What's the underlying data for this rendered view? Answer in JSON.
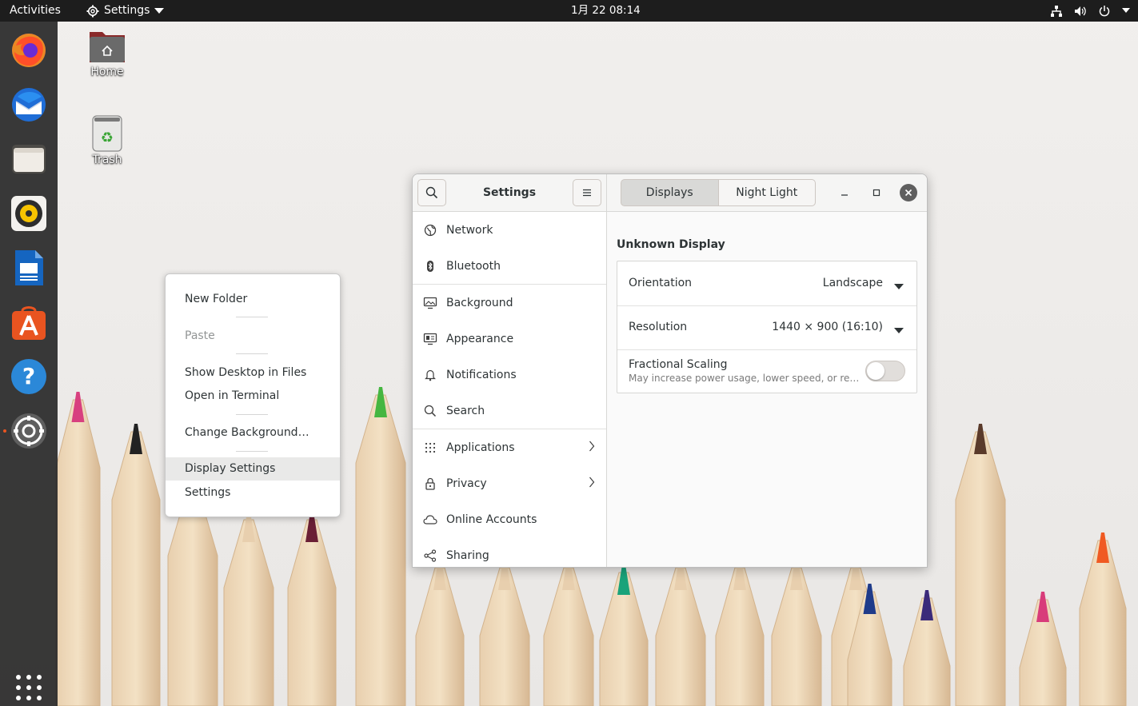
{
  "topbar": {
    "activities": "Activities",
    "app_menu": "Settings",
    "clock": "1月 22  08:14"
  },
  "dock": {
    "items": [
      "firefox-icon",
      "thunderbird-icon",
      "files-icon",
      "rhythmbox-icon",
      "libreoffice-writer-icon",
      "ubuntu-software-icon",
      "help-icon",
      "settings-icon"
    ],
    "show_apps": "show-applications-icon",
    "accent": "#e95420"
  },
  "desktop": {
    "home_label": "Home",
    "trash_label": "Trash"
  },
  "context_menu": {
    "items": [
      {
        "label": "New Folder",
        "enabled": true
      },
      {
        "label": "Paste",
        "enabled": false
      },
      {
        "label": "Show Desktop in Files",
        "enabled": true
      },
      {
        "label": "Open in Terminal",
        "enabled": true
      },
      {
        "label": "Change Background…",
        "enabled": true
      },
      {
        "label": "Display Settings",
        "enabled": true,
        "highlighted": true
      },
      {
        "label": "Settings",
        "enabled": true
      }
    ]
  },
  "settings": {
    "title": "Settings",
    "tabs": [
      "Displays",
      "Night Light"
    ],
    "active_tab": "Displays",
    "sidebar": [
      {
        "label": "Network",
        "icon": "network-icon"
      },
      {
        "label": "Bluetooth",
        "icon": "bluetooth-icon"
      },
      {
        "label": "Background",
        "icon": "background-icon"
      },
      {
        "label": "Appearance",
        "icon": "appearance-icon"
      },
      {
        "label": "Notifications",
        "icon": "bell-icon"
      },
      {
        "label": "Search",
        "icon": "search-icon"
      },
      {
        "label": "Applications",
        "icon": "applications-grid-icon"
      },
      {
        "label": "Privacy",
        "icon": "lock-icon"
      },
      {
        "label": "Online Accounts",
        "icon": "cloud-icon"
      },
      {
        "label": "Sharing",
        "icon": "share-icon"
      }
    ],
    "display": {
      "name": "Unknown Display",
      "orientation_label": "Orientation",
      "orientation_value": "Landscape",
      "resolution_label": "Resolution",
      "resolution_value": "1440 × 900 (16:10)",
      "fractional_label": "Fractional Scaling",
      "fractional_sub": "May increase power usage, lower speed, or reduce display sharpness.",
      "fractional_enabled": false
    }
  }
}
